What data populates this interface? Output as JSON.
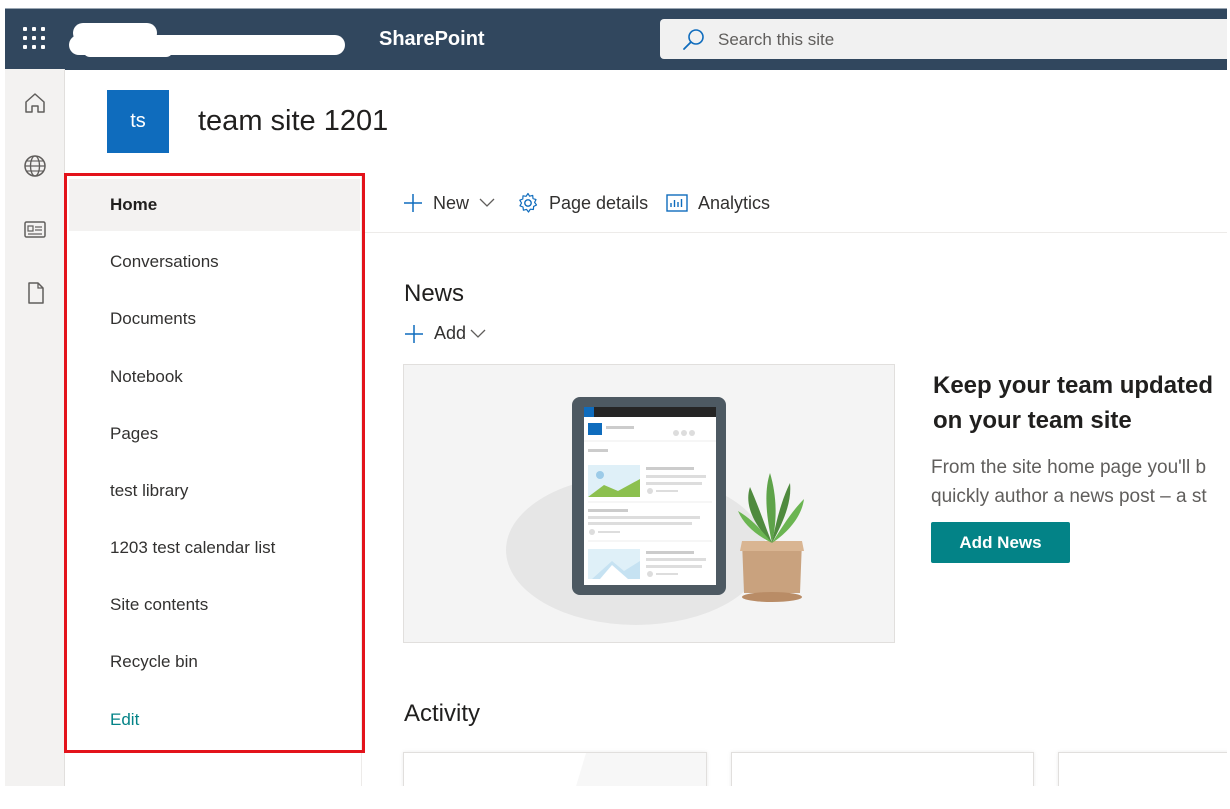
{
  "suite_bar": {
    "app_name": "SharePoint",
    "search_placeholder": "Search this site"
  },
  "site": {
    "logo_text": "ts",
    "title": "team site 1201",
    "logo_color": "#0f6cbd"
  },
  "app_bar": {
    "icons": [
      "home-icon",
      "globe-icon",
      "news-icon",
      "document-icon"
    ]
  },
  "nav": {
    "items": [
      {
        "label": "Home",
        "selected": true
      },
      {
        "label": "Conversations"
      },
      {
        "label": "Documents"
      },
      {
        "label": "Notebook"
      },
      {
        "label": "Pages"
      },
      {
        "label": "test library"
      },
      {
        "label": "1203 test calendar list"
      },
      {
        "label": "Site contents"
      },
      {
        "label": "Recycle bin"
      }
    ],
    "edit_label": "Edit"
  },
  "command_bar": {
    "new_label": "New",
    "page_details_label": "Page details",
    "analytics_label": "Analytics"
  },
  "news": {
    "title": "News",
    "add_label": "Add",
    "promo_heading_line1": "Keep your team updated",
    "promo_heading_line2": "on your team site",
    "promo_body_line1": "From the site home page you'll b",
    "promo_body_line2": "quickly author a news post – a st",
    "add_news_button": "Add News"
  },
  "activity": {
    "title": "Activity"
  },
  "colors": {
    "suite_bar": "#31475e",
    "accent": "#038387",
    "highlight_border": "#e3131b"
  }
}
